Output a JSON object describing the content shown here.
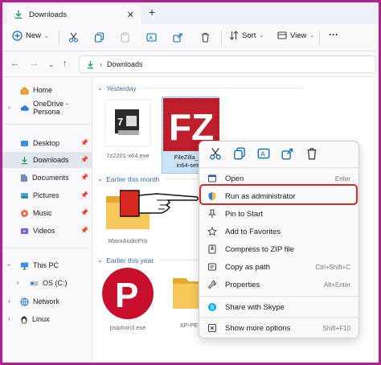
{
  "window": {
    "tab_title": "Downloads",
    "new_tab": "+",
    "controls": {
      "minimize": "—",
      "maximize": "▢",
      "close": "✕"
    }
  },
  "toolbar": {
    "new_label": "New",
    "sort_label": "Sort",
    "view_label": "View",
    "more": "···"
  },
  "address": {
    "crumb": "Downloads"
  },
  "sidebar": {
    "items": [
      {
        "label": "Home",
        "icon": "home-icon"
      },
      {
        "label": "OneDrive - Persona",
        "icon": "cloud-icon"
      },
      {
        "label": "Desktop",
        "icon": "desktop-icon"
      },
      {
        "label": "Downloads",
        "icon": "download-icon"
      },
      {
        "label": "Documents",
        "icon": "document-icon"
      },
      {
        "label": "Pictures",
        "icon": "picture-icon"
      },
      {
        "label": "Music",
        "icon": "music-icon"
      },
      {
        "label": "Videos",
        "icon": "video-icon"
      },
      {
        "label": "This PC",
        "icon": "computer-icon"
      },
      {
        "label": "OS (C:)",
        "icon": "drive-icon"
      },
      {
        "label": "Network",
        "icon": "network-icon"
      },
      {
        "label": "Linux",
        "icon": "linux-icon"
      }
    ]
  },
  "groups": {
    "yesterday": "Yesterday",
    "this_month": "Earlier this month",
    "this_year": "Earlier this year"
  },
  "files": {
    "zip": "7z2201-x64.exe",
    "filezilla_line1": "FileZilla_3.6",
    "filezilla_line2": "in64-setup",
    "folder1": "MaxxAudioPro",
    "psiphon": "psiphon3.exe",
    "folder2": "XP-PE"
  },
  "context_menu": {
    "items": [
      {
        "label": "Open",
        "shortcut": "Enter"
      },
      {
        "label": "Run as administrator",
        "shortcut": ""
      },
      {
        "label": "Pin to Start",
        "shortcut": ""
      },
      {
        "label": "Add to Favorites",
        "shortcut": ""
      },
      {
        "label": "Compress to ZIP file",
        "shortcut": ""
      },
      {
        "label": "Copy as path",
        "shortcut": "Ctrl+Shift+C"
      },
      {
        "label": "Properties",
        "shortcut": "Alt+Enter"
      },
      {
        "label": "Share with Skype",
        "shortcut": ""
      },
      {
        "label": "Show more options",
        "shortcut": "Shift+F10"
      }
    ]
  },
  "colors": {
    "frame": "#b0208f",
    "highlight": "#d9272c",
    "filezilla": "#bf1e2d",
    "psiphon": "#c8102e",
    "folder": "#f4c04e",
    "accent": "#0f6cbd"
  }
}
